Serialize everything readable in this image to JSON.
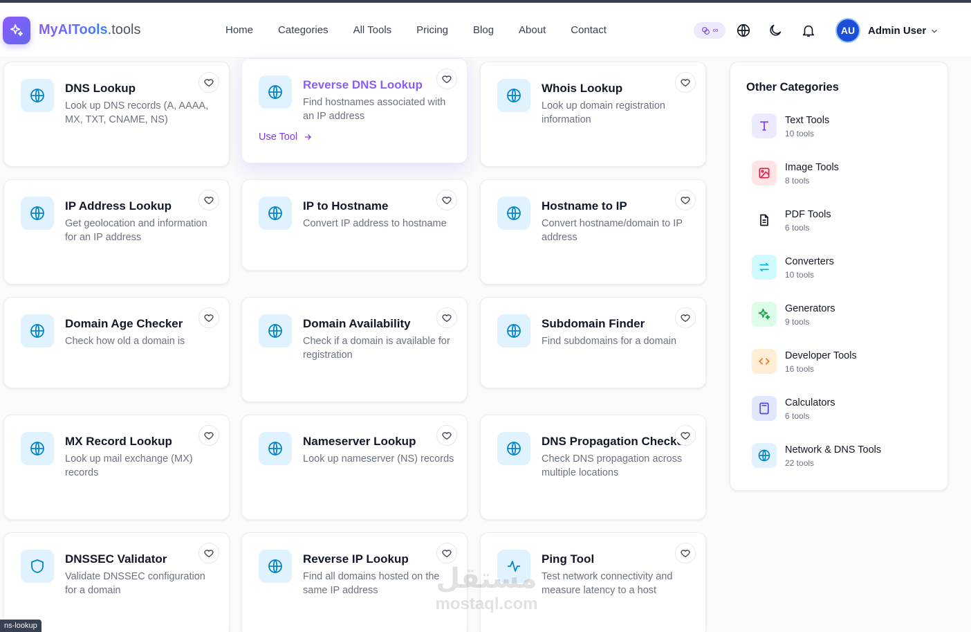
{
  "header": {
    "brand_main": "MyAITools",
    "brand_suffix": ".tools",
    "nav": [
      "Home",
      "Categories",
      "All Tools",
      "Pricing",
      "Blog",
      "About",
      "Contact"
    ],
    "credits_label": "∞",
    "avatar_initials": "AU",
    "user_name": "Admin User"
  },
  "tools": [
    {
      "title": "DNS Lookup",
      "desc": "Look up DNS records (A, AAAA, MX, TXT, CNAME, NS)",
      "icon": "globe-icon"
    },
    {
      "title": "Reverse DNS Lookup",
      "desc": "Find hostnames associated with an IP address",
      "icon": "globe-icon",
      "active": true,
      "action": "Use Tool"
    },
    {
      "title": "Whois Lookup",
      "desc": "Look up domain registration information",
      "icon": "globe-icon"
    },
    {
      "title": "IP Address Lookup",
      "desc": "Get geolocation and information for an IP address",
      "icon": "globe-icon"
    },
    {
      "title": "IP to Hostname",
      "desc": "Convert IP address to hostname",
      "icon": "globe-icon"
    },
    {
      "title": "Hostname to IP",
      "desc": "Convert hostname/domain to IP address",
      "icon": "globe-icon"
    },
    {
      "title": "Domain Age Checker",
      "desc": "Check how old a domain is",
      "icon": "globe-icon"
    },
    {
      "title": "Domain Availability",
      "desc": "Check if a domain is available for registration",
      "icon": "globe-icon"
    },
    {
      "title": "Subdomain Finder",
      "desc": "Find subdomains for a domain",
      "icon": "globe-icon"
    },
    {
      "title": "MX Record Lookup",
      "desc": "Look up mail exchange (MX) records",
      "icon": "globe-icon"
    },
    {
      "title": "Nameserver Lookup",
      "desc": "Look up nameserver (NS) records",
      "icon": "globe-icon"
    },
    {
      "title": "DNS Propagation Checker",
      "desc": "Check DNS propagation across multiple locations",
      "icon": "globe-icon"
    },
    {
      "title": "DNSSEC Validator",
      "desc": "Validate DNSSEC configuration for a domain",
      "icon": "shield-icon"
    },
    {
      "title": "Reverse IP Lookup",
      "desc": "Find all domains hosted on the same IP address",
      "icon": "globe-icon"
    },
    {
      "title": "Ping Tool",
      "desc": "Test network connectivity and measure latency to a host",
      "icon": "activity-icon"
    }
  ],
  "sidebar": {
    "title": "Other Categories",
    "categories": [
      {
        "name": "Text Tools",
        "count": "10 tools",
        "icon": "text-icon",
        "color": "#7c3aed",
        "bg": "#ede9fe"
      },
      {
        "name": "Image Tools",
        "count": "8 tools",
        "icon": "image-icon",
        "color": "#e11d48",
        "bg": "#ffe4e6"
      },
      {
        "name": "PDF Tools",
        "count": "6 tools",
        "icon": "file-icon",
        "color": "#111827",
        "bg": "#ffffff"
      },
      {
        "name": "Converters",
        "count": "10 tools",
        "icon": "arrows-icon",
        "color": "#06b6d4",
        "bg": "#cffafe"
      },
      {
        "name": "Generators",
        "count": "9 tools",
        "icon": "sparkles-icon",
        "color": "#16a34a",
        "bg": "#dcfce7"
      },
      {
        "name": "Developer Tools",
        "count": "16 tools",
        "icon": "code-icon",
        "color": "#f97316",
        "bg": "#ffedd5"
      },
      {
        "name": "Calculators",
        "count": "6 tools",
        "icon": "calculator-icon",
        "color": "#4f46e5",
        "bg": "#e0e7ff"
      },
      {
        "name": "Network & DNS Tools",
        "count": "22 tools",
        "icon": "globe-icon",
        "color": "#0284c7",
        "bg": "#e0f2fe"
      }
    ]
  },
  "status_tip": "ns-lookup",
  "watermark": {
    "arabic": "مستقل",
    "latin": "mostaql.com"
  }
}
